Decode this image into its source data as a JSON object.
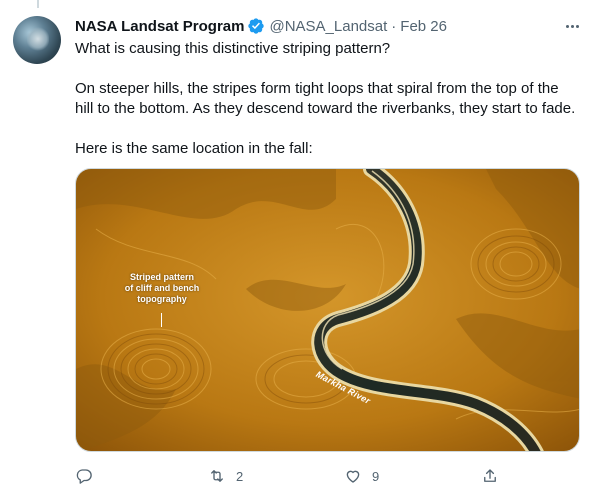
{
  "tweet": {
    "author_name": "NASA Landsat Program",
    "handle": "@NASA_Landsat",
    "separator": "·",
    "date": "Feb 26",
    "text": {
      "line1": "What is causing this distinctive striping pattern?",
      "line2": "On steeper hills, the stripes form tight loops that spiral from the top of the",
      "line3": "hill to the bottom. As they descend toward the riverbanks, they start to fade.",
      "line4": "Here is the same location in the fall:"
    },
    "image": {
      "annotation": [
        "Striped pattern",
        "of cliff and bench",
        "topography"
      ],
      "river_label": "Markha River"
    },
    "actions": {
      "reply_count": "",
      "retweet_count": "2",
      "like_count": "9"
    }
  },
  "colors": {
    "verified_blue": "#1d9bf0",
    "muted_text": "#536471",
    "terrain": "#c98a1c"
  },
  "icons": [
    "verified-badge-icon",
    "more-icon",
    "reply-icon",
    "retweet-icon",
    "like-icon",
    "share-icon"
  ]
}
